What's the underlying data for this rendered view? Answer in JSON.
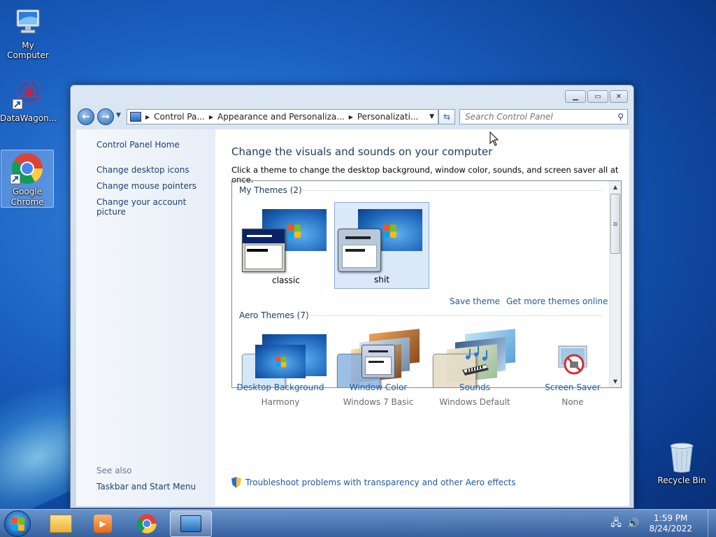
{
  "desktop": {
    "icons": [
      {
        "label": "My Computer"
      },
      {
        "label": "DataWagon..."
      },
      {
        "label": "Google Chrome"
      },
      {
        "label": "Recycle Bin"
      }
    ]
  },
  "window": {
    "address": {
      "seg1": "Control Pa...",
      "seg2": "Appearance and Personaliza...",
      "seg3": "Personalizati..."
    },
    "search_placeholder": "Search Control Panel",
    "left_pane": {
      "home": "Control Panel Home",
      "links": [
        "Change desktop icons",
        "Change mouse pointers",
        "Change your account picture"
      ],
      "see_also_heading": "See also",
      "see_also_link": "Taskbar and Start Menu"
    },
    "heading": "Change the visuals and sounds on your computer",
    "description": "Click a theme to change the desktop background, window color, sounds, and screen saver all at once.",
    "my_themes_heading": "My Themes (2)",
    "my_themes": [
      {
        "name": "classic"
      },
      {
        "name": "shit"
      }
    ],
    "save_theme": "Save theme",
    "get_more": "Get more themes online",
    "aero_heading": "Aero Themes (7)",
    "bottom": [
      {
        "label": "Desktop Background",
        "value": "Harmony",
        "icon": "desktop-background-icon"
      },
      {
        "label": "Window Color",
        "value": "Windows 7 Basic",
        "icon": "window-color-icon"
      },
      {
        "label": "Sounds",
        "value": "Windows Default",
        "icon": "sounds-icon"
      },
      {
        "label": "Screen Saver",
        "value": "None",
        "icon": "screen-saver-icon"
      }
    ],
    "troubleshoot": "Troubleshoot problems with transparency and other Aero effects",
    "help_glyph": "?"
  },
  "taskbar": {
    "time": "1:59 PM",
    "date": "8/24/2022"
  },
  "colors": {
    "link": "#1e5a9e",
    "heading": "#1e395b",
    "selection": "#dbe9fa"
  }
}
